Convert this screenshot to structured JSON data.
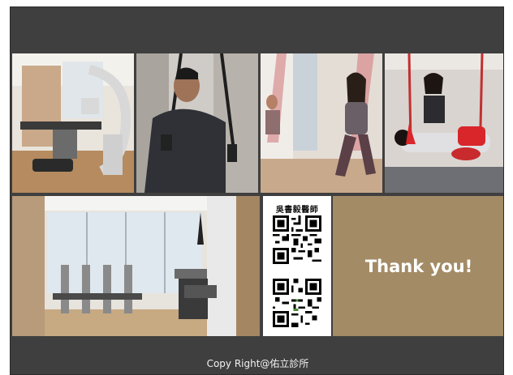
{
  "qr": {
    "title": "吳書毅醫師"
  },
  "panel": {
    "thanks": "Thank you!"
  },
  "footer": {
    "copyright": "Copy Right@佑立診所"
  },
  "colors": {
    "slide_background": "#3f3f3f",
    "thanks_panel": "#a38b65",
    "qr_panel": "#ffffff"
  }
}
